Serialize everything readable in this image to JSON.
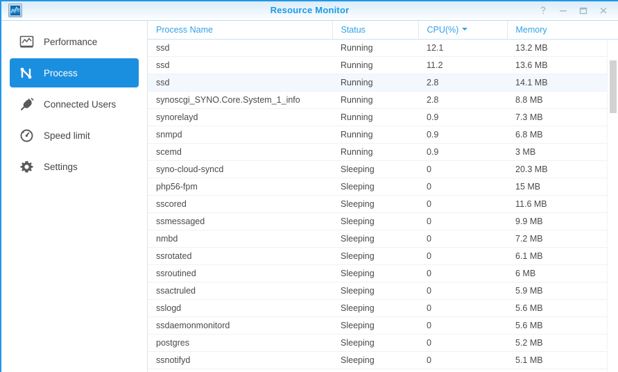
{
  "window": {
    "title": "Resource Monitor",
    "app_icon": "chart-monitor-icon",
    "controls": [
      {
        "name": "help-button",
        "glyph": "?"
      },
      {
        "name": "minimize-button",
        "glyph": "–"
      },
      {
        "name": "maximize-button",
        "glyph": "□"
      },
      {
        "name": "close-button",
        "glyph": "✕"
      }
    ]
  },
  "sidebar": {
    "items": [
      {
        "label": "Performance",
        "icon": "performance-chart-icon",
        "selected": false
      },
      {
        "label": "Process",
        "icon": "process-graph-icon",
        "selected": true
      },
      {
        "label": "Connected Users",
        "icon": "plug-connector-icon",
        "selected": false
      },
      {
        "label": "Speed limit",
        "icon": "speedometer-icon",
        "selected": false
      },
      {
        "label": "Settings",
        "icon": "gear-icon",
        "selected": false
      }
    ]
  },
  "table": {
    "columns": [
      {
        "label": "Process Name",
        "key": "name",
        "sorted": false
      },
      {
        "label": "Status",
        "key": "status",
        "sorted": false
      },
      {
        "label": "CPU(%)",
        "key": "cpu",
        "sorted": true,
        "sort_direction": "desc"
      },
      {
        "label": "Memory",
        "key": "memory",
        "sorted": false
      }
    ],
    "rows": [
      {
        "name": "ssd",
        "status": "Running",
        "cpu": "12.1",
        "memory": "13.2 MB",
        "highlighted": false
      },
      {
        "name": "ssd",
        "status": "Running",
        "cpu": "11.2",
        "memory": "13.6 MB",
        "highlighted": false
      },
      {
        "name": "ssd",
        "status": "Running",
        "cpu": "2.8",
        "memory": "14.1 MB",
        "highlighted": true
      },
      {
        "name": "synoscgi_SYNO.Core.System_1_info",
        "status": "Running",
        "cpu": "2.8",
        "memory": "8.8 MB",
        "highlighted": false
      },
      {
        "name": "synorelayd",
        "status": "Running",
        "cpu": "0.9",
        "memory": "7.3 MB",
        "highlighted": false
      },
      {
        "name": "snmpd",
        "status": "Running",
        "cpu": "0.9",
        "memory": "6.8 MB",
        "highlighted": false
      },
      {
        "name": "scemd",
        "status": "Running",
        "cpu": "0.9",
        "memory": "3 MB",
        "highlighted": false
      },
      {
        "name": "syno-cloud-syncd",
        "status": "Sleeping",
        "cpu": "0",
        "memory": "20.3 MB",
        "highlighted": false
      },
      {
        "name": "php56-fpm",
        "status": "Sleeping",
        "cpu": "0",
        "memory": "15 MB",
        "highlighted": false
      },
      {
        "name": "sscored",
        "status": "Sleeping",
        "cpu": "0",
        "memory": "11.6 MB",
        "highlighted": false
      },
      {
        "name": "ssmessaged",
        "status": "Sleeping",
        "cpu": "0",
        "memory": "9.9 MB",
        "highlighted": false
      },
      {
        "name": "nmbd",
        "status": "Sleeping",
        "cpu": "0",
        "memory": "7.2 MB",
        "highlighted": false
      },
      {
        "name": "ssrotated",
        "status": "Sleeping",
        "cpu": "0",
        "memory": "6.1 MB",
        "highlighted": false
      },
      {
        "name": "ssroutined",
        "status": "Sleeping",
        "cpu": "0",
        "memory": "6 MB",
        "highlighted": false
      },
      {
        "name": "ssactruled",
        "status": "Sleeping",
        "cpu": "0",
        "memory": "5.9 MB",
        "highlighted": false
      },
      {
        "name": "sslogd",
        "status": "Sleeping",
        "cpu": "0",
        "memory": "5.6 MB",
        "highlighted": false
      },
      {
        "name": "ssdaemonmonitord",
        "status": "Sleeping",
        "cpu": "0",
        "memory": "5.6 MB",
        "highlighted": false
      },
      {
        "name": "postgres",
        "status": "Sleeping",
        "cpu": "0",
        "memory": "5.2 MB",
        "highlighted": false
      },
      {
        "name": "ssnotifyd",
        "status": "Sleeping",
        "cpu": "0",
        "memory": "5.1 MB",
        "highlighted": false
      }
    ]
  },
  "colors": {
    "accent": "#1a8fe0",
    "title_text": "#1b9ae8",
    "header_text": "#31a2e8",
    "row_text": "#4a4a4a",
    "row_highlight": "#f2f8fd",
    "scrollbar_thumb": "#d2d2d2"
  }
}
